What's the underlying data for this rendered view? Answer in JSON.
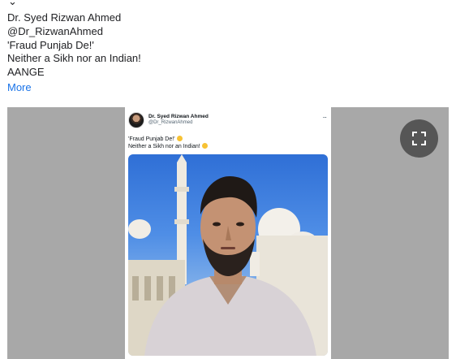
{
  "post": {
    "author_name": "Dr. Syed Rizwan Ahmed",
    "author_handle": "@Dr_RizwanAhmed",
    "lines": [
      "'Fraud Punjab De!'",
      "Neither a Sikh nor an Indian!",
      "AANGE"
    ],
    "more_label": "More"
  },
  "media": {
    "embedded_tweet": {
      "author_name": "Dr. Syed Rizwan Ahmed",
      "author_handle": "@Dr_RizwanAhmed",
      "more_icon": "...",
      "line1": "'Fraud Punjab De!'",
      "line2": "Neither a Sikh nor an Indian!",
      "photo_icon": "selfie-photo"
    },
    "expand_icon": "fullscreen-expand-icon",
    "background_color": "#a8a8a8"
  }
}
